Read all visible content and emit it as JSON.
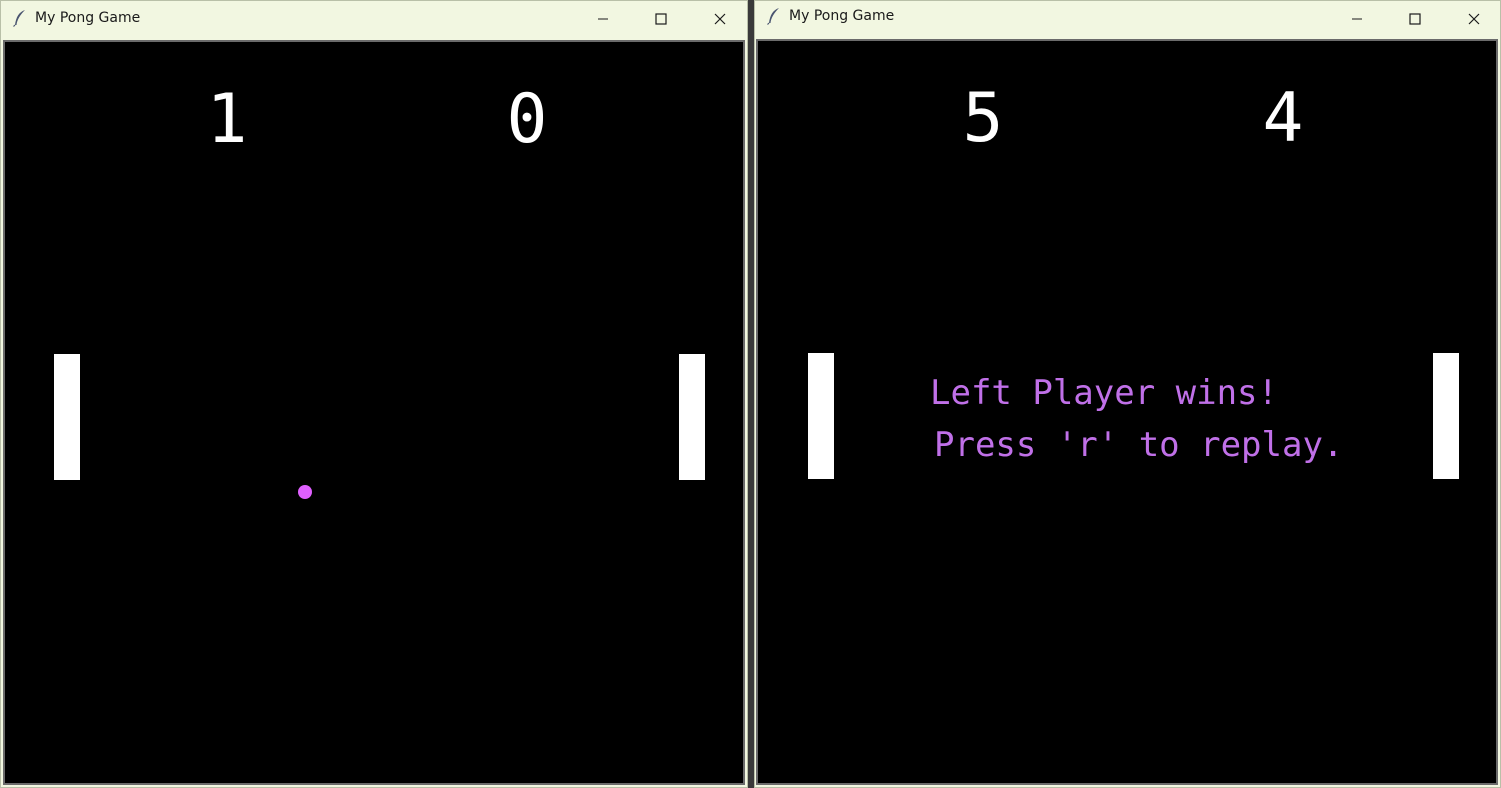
{
  "colors": {
    "ball": "#e060ff",
    "message": "#c070e8",
    "titlebar": "#f2f7e1",
    "canvas": "#000000"
  },
  "windows": [
    {
      "title": "My Pong Game",
      "icon": "feather-icon",
      "controls": [
        "minimize-icon",
        "maximize-icon",
        "close-icon"
      ],
      "scores": {
        "left": "1",
        "right": "0"
      },
      "ball_visible": true,
      "message_lines": []
    },
    {
      "title": "My Pong Game",
      "icon": "feather-icon",
      "controls": [
        "minimize-icon",
        "maximize-icon",
        "close-icon"
      ],
      "scores": {
        "left": "5",
        "right": "4"
      },
      "ball_visible": false,
      "message_lines": [
        "Left Player wins!",
        "Press 'r' to replay."
      ]
    }
  ]
}
